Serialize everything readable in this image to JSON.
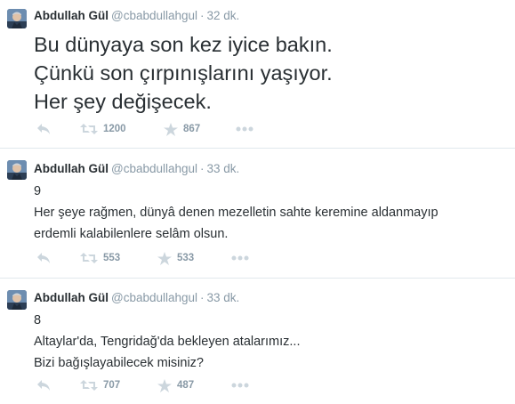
{
  "colors": {
    "muted": "#8899a6",
    "text": "#292f33",
    "divider": "#e1e8ed"
  },
  "tweets": [
    {
      "name": "Abdullah Gül",
      "handle": "@cbabdullahgul",
      "separator": "·",
      "time": "32 dk.",
      "lines": [
        "Bu dünyaya son kez iyice bakın.",
        "Çünkü son çırpınışlarını yaşıyor.",
        "Her şey değişecek."
      ],
      "retweets": "1200",
      "favorites": "867",
      "icons": {
        "reply": "reply-icon",
        "retweet": "retweet-icon",
        "favorite": "star-icon",
        "more": "more-icon"
      }
    },
    {
      "name": "Abdullah Gül",
      "handle": "@cbabdullahgul",
      "separator": "·",
      "time": "33 dk.",
      "lines": [
        "9",
        "Her şeye rağmen, dünyâ denen mezelletin sahte keremine aldanmayıp",
        "erdemli kalabilenlere selâm olsun."
      ],
      "retweets": "553",
      "favorites": "533",
      "icons": {
        "reply": "reply-icon",
        "retweet": "retweet-icon",
        "favorite": "star-icon",
        "more": "more-icon"
      }
    },
    {
      "name": "Abdullah Gül",
      "handle": "@cbabdullahgul",
      "separator": "·",
      "time": "33 dk.",
      "lines": [
        "8",
        "Altaylar'da, Tengridağ'da bekleyen atalarımız...",
        "Bizi bağışlayabilecek misiniz?"
      ],
      "retweets": "707",
      "favorites": "487",
      "icons": {
        "reply": "reply-icon",
        "retweet": "retweet-icon",
        "favorite": "star-icon",
        "more": "more-icon"
      }
    }
  ]
}
